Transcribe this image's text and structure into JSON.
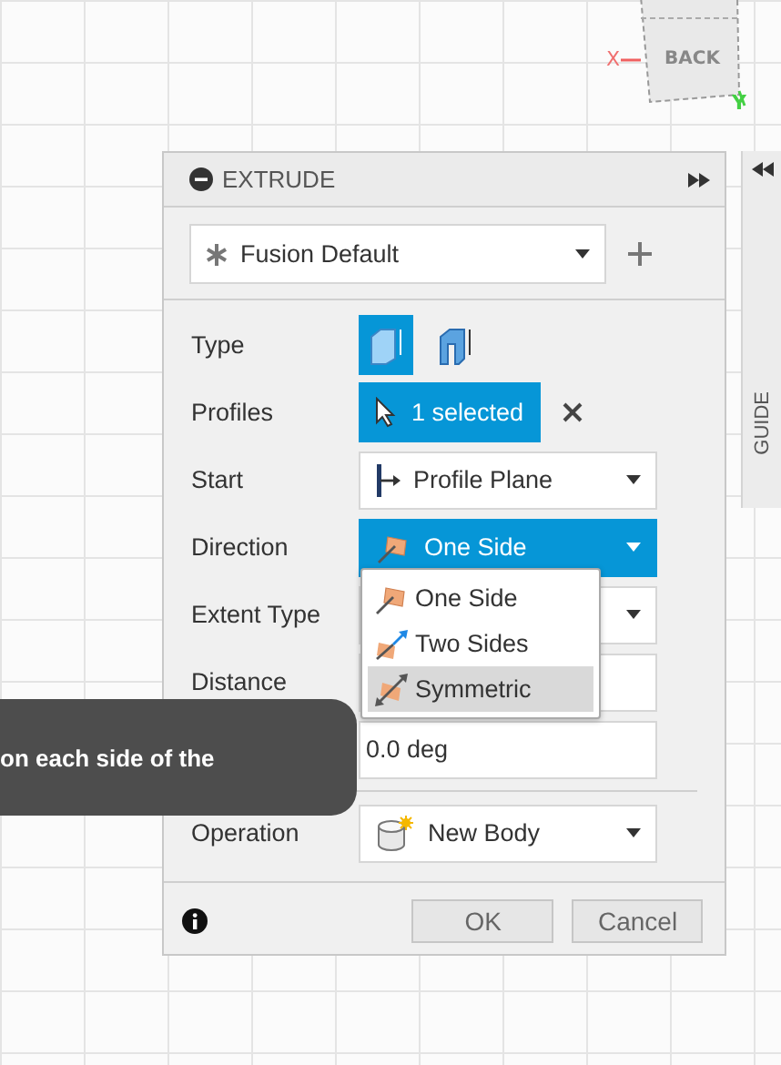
{
  "viewcube": {
    "face": "BACK",
    "x_axis": "X",
    "y_axis": "Y"
  },
  "panel": {
    "title": "EXTRUDE",
    "preset": "Fusion Default",
    "type_options": [
      {
        "selected": true
      },
      {
        "selected": false
      }
    ],
    "rows": [
      {
        "kind": "type",
        "label": "Type"
      },
      {
        "kind": "selection",
        "label": "Profiles",
        "value": "1 selected"
      },
      {
        "kind": "dropdown",
        "label": "Start",
        "value": "Profile Plane",
        "active": false
      },
      {
        "kind": "dropdown",
        "label": "Direction",
        "value": "One Side",
        "active": true
      },
      {
        "kind": "dropdown",
        "label": "Extent Type",
        "active": false
      },
      {
        "kind": "input",
        "label": "Distance"
      },
      {
        "kind": "input",
        "value": "0.0 deg"
      },
      {
        "kind": "divider"
      },
      {
        "kind": "dropdown",
        "label": "Operation",
        "value": "New Body",
        "active": false
      }
    ],
    "buttons": [
      {
        "label": "OK"
      },
      {
        "label": "Cancel"
      }
    ]
  },
  "direction_menu": [
    {
      "label": "One Side",
      "selected": false
    },
    {
      "label": "Two Sides",
      "selected": false
    },
    {
      "label": "Symmetric",
      "selected": true
    }
  ],
  "guide_tab": {
    "label": "GUIDE"
  },
  "tooltip": {
    "text": "on each side of the"
  }
}
